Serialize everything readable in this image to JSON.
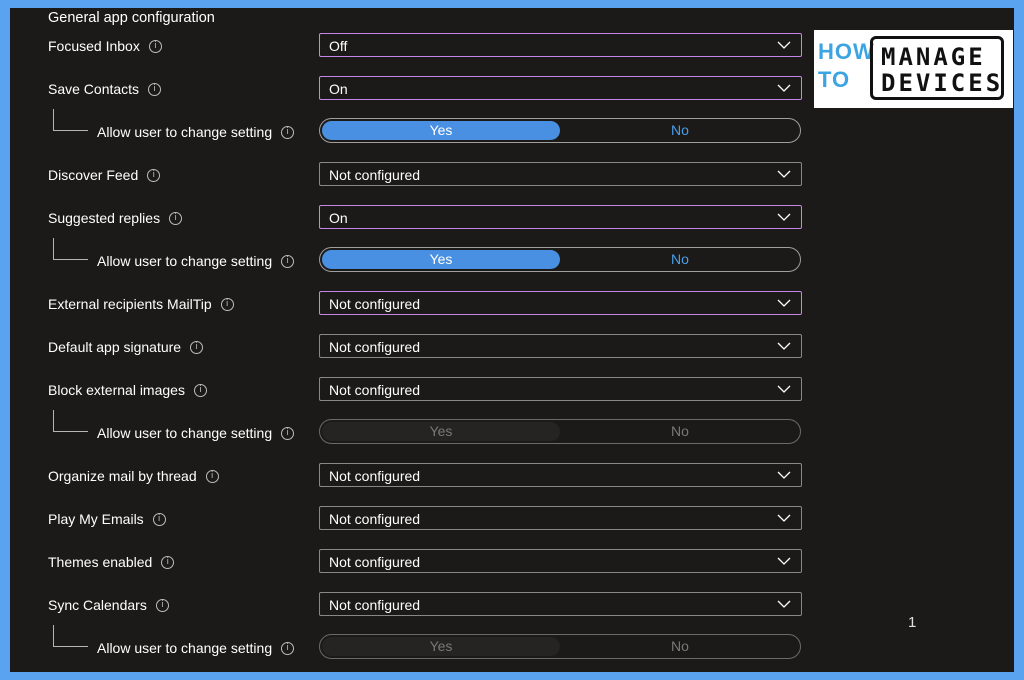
{
  "section_title": "General app configuration",
  "rows": [
    {
      "label": "Focused Inbox",
      "value": "Off"
    },
    {
      "label": "Save Contacts",
      "value": "On"
    },
    {
      "label": "Allow user to change setting",
      "yes": "Yes",
      "no": "No",
      "state": "Yes"
    },
    {
      "label": "Discover Feed",
      "value": "Not configured"
    },
    {
      "label": "Suggested replies",
      "value": "On"
    },
    {
      "label": "Allow user to change setting",
      "yes": "Yes",
      "no": "No",
      "state": "Yes"
    },
    {
      "label": "External recipients MailTip",
      "value": "Not configured"
    },
    {
      "label": "Default app signature",
      "value": "Not configured"
    },
    {
      "label": "Block external images",
      "value": "Not configured"
    },
    {
      "label": "Allow user to change setting",
      "yes": "Yes",
      "no": "No",
      "state": "disabled"
    },
    {
      "label": "Organize mail by thread",
      "value": "Not configured"
    },
    {
      "label": "Play My Emails",
      "value": "Not configured"
    },
    {
      "label": "Themes enabled",
      "value": "Not configured"
    },
    {
      "label": "Sync Calendars",
      "value": "Not configured"
    },
    {
      "label": "Allow user to change setting",
      "yes": "Yes",
      "no": "No",
      "state": "disabled"
    }
  ],
  "logo": {
    "how": "HOW",
    "to": "TO",
    "line1": "MANAGE",
    "line2": "DEVICES"
  },
  "page_number": "1",
  "colors": {
    "accent": "#4a90e2",
    "focus_border": "#c586e8",
    "background": "#1b1a19",
    "frame": "#5aa3f0"
  }
}
